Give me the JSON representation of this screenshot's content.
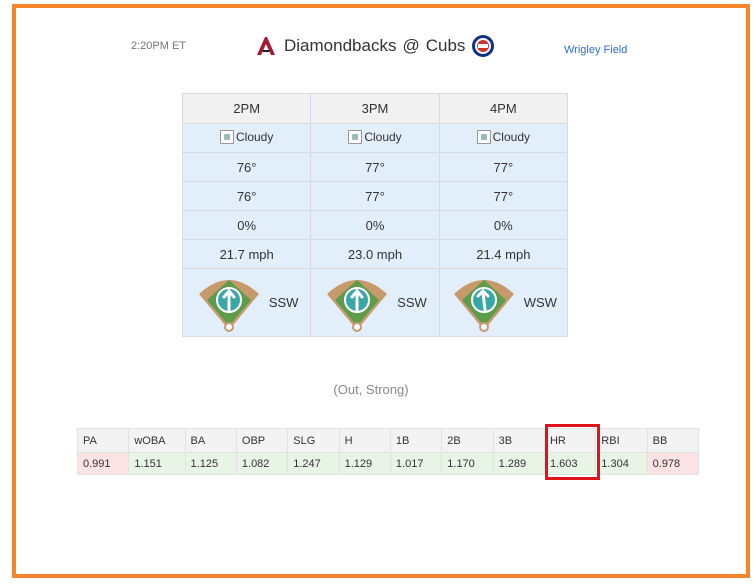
{
  "header": {
    "time": "2:20PM ET",
    "away_team": "Diamondbacks",
    "separator": "@",
    "home_team": "Cubs",
    "stadium": "Wrigley Field"
  },
  "weather": {
    "hours": [
      "2PM",
      "3PM",
      "4PM"
    ],
    "condition_alt": [
      "Cloudy",
      "Cloudy",
      "Cloudy"
    ],
    "temp": [
      "76°",
      "77°",
      "77°"
    ],
    "feels_like": [
      "76°",
      "77°",
      "77°"
    ],
    "precip": [
      "0%",
      "0%",
      "0%"
    ],
    "wind_speed": [
      "21.7 mph",
      "23.0 mph",
      "21.4 mph"
    ],
    "wind_dir": [
      "SSW",
      "SSW",
      "WSW"
    ]
  },
  "summary": "(Out, Strong)",
  "stats": {
    "headers": [
      "PA",
      "wOBA",
      "BA",
      "OBP",
      "SLG",
      "H",
      "1B",
      "2B",
      "3B",
      "HR",
      "RBI",
      "BB"
    ],
    "values": [
      "0.991",
      "1.151",
      "1.125",
      "1.082",
      "1.247",
      "1.129",
      "1.017",
      "1.170",
      "1.289",
      "1.603",
      "1.304",
      "0.978"
    ],
    "tone": [
      "neg",
      "pos",
      "pos",
      "pos",
      "pos",
      "pos",
      "pos",
      "pos",
      "pos",
      "pos",
      "pos",
      "neg"
    ]
  },
  "colors": {
    "frame_border": "#f5862b",
    "highlight": "#e0121b",
    "positive_bg": "#e8f5e6",
    "negative_bg": "#fbe3e3",
    "weather_bg": "#e3eefb",
    "link": "#2a6fdb"
  }
}
